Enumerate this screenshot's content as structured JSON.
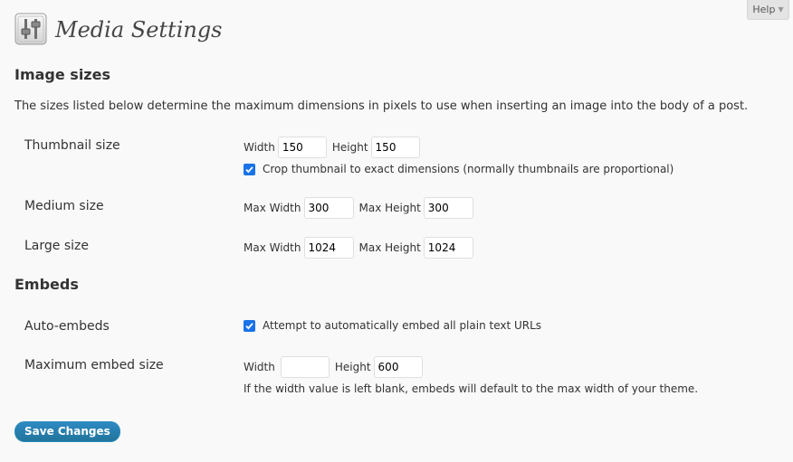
{
  "help_tab": {
    "label": "Help",
    "arrow": "▼"
  },
  "page": {
    "title": "Media Settings",
    "icon": "settings-sliders-icon"
  },
  "image_sizes": {
    "heading": "Image sizes",
    "intro": "The sizes listed below determine the maximum dimensions in pixels to use when inserting an image into the body of a post.",
    "thumbnail": {
      "label": "Thumbnail size",
      "width_label": "Width",
      "width_value": "150",
      "height_label": "Height",
      "height_value": "150",
      "crop_checked": true,
      "crop_label": "Crop thumbnail to exact dimensions (normally thumbnails are proportional)"
    },
    "medium": {
      "label": "Medium size",
      "width_label": "Max Width",
      "width_value": "300",
      "height_label": "Max Height",
      "height_value": "300"
    },
    "large": {
      "label": "Large size",
      "width_label": "Max Width",
      "width_value": "1024",
      "height_label": "Max Height",
      "height_value": "1024"
    }
  },
  "embeds": {
    "heading": "Embeds",
    "auto": {
      "label": "Auto-embeds",
      "checked": true,
      "checkbox_label": "Attempt to automatically embed all plain text URLs"
    },
    "max_size": {
      "label": "Maximum embed size",
      "width_label": "Width",
      "width_value": "",
      "height_label": "Height",
      "height_value": "600",
      "note": "If the width value is left blank, embeds will default to the max width of your theme."
    }
  },
  "actions": {
    "save_label": "Save Changes"
  },
  "colors": {
    "accent": "#21759b",
    "checkbox": "#1a73e8"
  }
}
